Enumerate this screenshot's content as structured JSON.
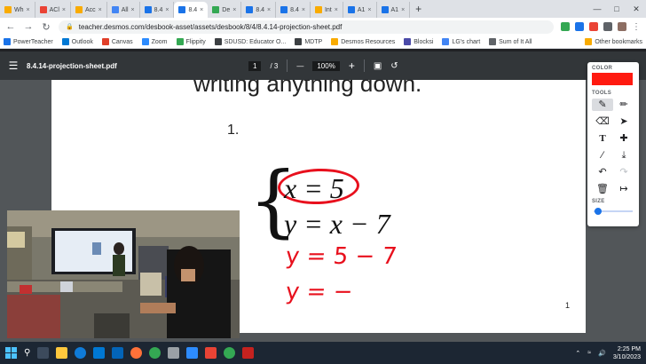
{
  "tabs": [
    {
      "label": "Wh",
      "color": "#f9ab00",
      "active": false
    },
    {
      "label": "ACl",
      "color": "#ea4335",
      "active": false
    },
    {
      "label": "Acc",
      "color": "#f9ab00",
      "active": false
    },
    {
      "label": "All",
      "color": "#4285f4",
      "active": false
    },
    {
      "label": "8.4",
      "color": "#1a73e8",
      "active": false
    },
    {
      "label": "8.4",
      "color": "#1a73e8",
      "active": true
    },
    {
      "label": "De",
      "color": "#34a853",
      "active": false
    },
    {
      "label": "8.4",
      "color": "#1a73e8",
      "active": false
    },
    {
      "label": "8.4",
      "color": "#1a73e8",
      "active": false
    },
    {
      "label": "Int",
      "color": "#f9ab00",
      "active": false
    },
    {
      "label": "A1",
      "color": "#1a73e8",
      "active": false
    },
    {
      "label": "A1",
      "color": "#1a73e8",
      "active": false
    }
  ],
  "url": "teacher.desmos.com/desbook-asset/assets/desbook/8/4/8.4.14-projection-sheet.pdf",
  "bookmarks": [
    {
      "label": "PowerTeacher",
      "color": "#1a73e8"
    },
    {
      "label": "Outlook",
      "color": "#0078d4"
    },
    {
      "label": "Canvas",
      "color": "#e13f29"
    },
    {
      "label": "Zoom",
      "color": "#2d8cff"
    },
    {
      "label": "Flippity",
      "color": "#34a853"
    },
    {
      "label": "SDUSD: Educator O...",
      "color": "#3c4043"
    },
    {
      "label": "MDTP",
      "color": "#3c4043"
    },
    {
      "label": "Desmos Resources",
      "color": "#f9ab00"
    },
    {
      "label": "Blocksi",
      "color": "#4a4aa8"
    },
    {
      "label": "LG's chart",
      "color": "#4285f4"
    },
    {
      "label": "Sum of It All",
      "color": "#5f6368"
    }
  ],
  "other_bookmarks": "Other bookmarks",
  "pdf": {
    "filename": "8.4.14-projection-sheet.pdf",
    "page_current": "1",
    "page_total": "/ 3",
    "zoom": "100%",
    "zoom_out": "—",
    "zoom_in": "+"
  },
  "document": {
    "heading_partial": "writing anything down.",
    "problem_number": "1.",
    "equation_1": "x = 5",
    "equation_2": "y = x − 7",
    "handwriting_1": "y = 5 − 7",
    "handwriting_2": "y = −",
    "page_number": "1"
  },
  "drawing_panel": {
    "color_label": "COLOR",
    "current_color": "#ff1a10",
    "tools_label": "TOOLS",
    "size_label": "SIZE",
    "tools": [
      "pen-icon",
      "highlighter-icon",
      "eraser-icon",
      "select-arrow-icon",
      "text-icon",
      "move-icon",
      "line-icon",
      "download-icon",
      "undo-icon",
      "redo-icon",
      "trash-icon",
      "exit-icon"
    ]
  },
  "taskbar": {
    "time": "2:25 PM",
    "date": "3/10/2023"
  }
}
